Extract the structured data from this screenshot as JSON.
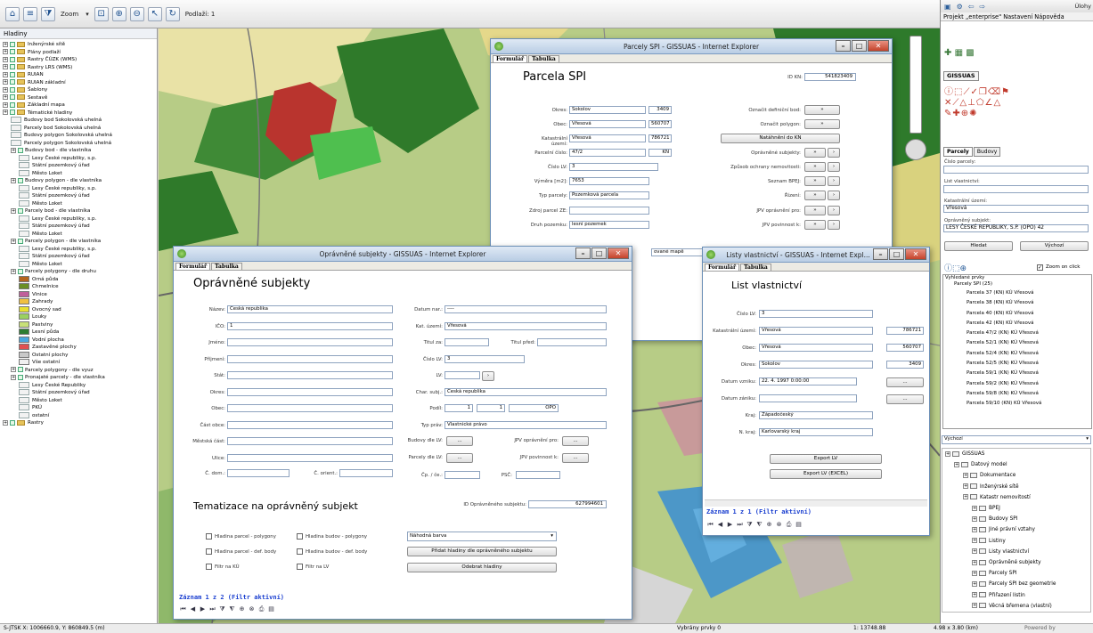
{
  "toolbar": {
    "zoom_label": "Zoom",
    "levels_label": "Podlaží: 1"
  },
  "status": {
    "coords": "S-JTSK X: 1006660.9, Y: 860849.5 (m)",
    "selected": "Vybrány prvky 0",
    "scale": "1: 13748.88",
    "size": "4.98 x 3.80 (km)",
    "powered": "Powered by"
  },
  "layers": {
    "title": "Hladiny",
    "items": [
      {
        "label": "Inženýrské sítě",
        "level": 0,
        "kind": "folder"
      },
      {
        "label": "Plány podlaží",
        "level": 0,
        "kind": "folder"
      },
      {
        "label": "Rastry ČÚZK (WMS)",
        "level": 0,
        "kind": "folder"
      },
      {
        "label": "Rastry LRS (WMS)",
        "level": 0,
        "kind": "folder"
      },
      {
        "label": "RUIAN",
        "level": 0,
        "kind": "folder"
      },
      {
        "label": "RUIAN základní",
        "level": 0,
        "kind": "folder"
      },
      {
        "label": "Šablony",
        "level": 0,
        "kind": "folder"
      },
      {
        "label": "Sestavě",
        "level": 0,
        "kind": "folder"
      },
      {
        "label": "Základní mapa",
        "level": 0,
        "kind": "folder"
      },
      {
        "label": "Tématické hladiny",
        "level": 0,
        "kind": "folder"
      },
      {
        "label": "Budovy bod Sokolovská uhelná",
        "level": 1,
        "kind": "layer"
      },
      {
        "label": "Parcely bod Sokolovská uhelná",
        "level": 1,
        "kind": "layer"
      },
      {
        "label": "Budovy polygon Sokolovská uhelná",
        "level": 1,
        "kind": "layer"
      },
      {
        "label": "Parcely polygon Sokolovská uhelná",
        "level": 1,
        "kind": "layer"
      },
      {
        "label": "Budovy bod - dle vlastníka",
        "level": 1,
        "kind": "group"
      },
      {
        "label": "Lesy České republiky, s.p.",
        "level": 2,
        "kind": "item"
      },
      {
        "label": "Státní pozemkový úřad",
        "level": 2,
        "kind": "item"
      },
      {
        "label": "Město Loket",
        "level": 2,
        "kind": "item"
      },
      {
        "label": "Budovy polygon - dle vlastníka",
        "level": 1,
        "kind": "group"
      },
      {
        "label": "Lesy České republiky, s.p.",
        "level": 2,
        "kind": "item"
      },
      {
        "label": "Státní pozemkový úřad",
        "level": 2,
        "kind": "item"
      },
      {
        "label": "Město Loket",
        "level": 2,
        "kind": "item"
      },
      {
        "label": "Parcely bod - dle vlastníka",
        "level": 1,
        "kind": "group"
      },
      {
        "label": "Lesy České republiky, s.p.",
        "level": 2,
        "kind": "item"
      },
      {
        "label": "Státní pozemkový úřad",
        "level": 2,
        "kind": "item"
      },
      {
        "label": "Město Loket",
        "level": 2,
        "kind": "item"
      },
      {
        "label": "Parcely polygon - dle vlastníka",
        "level": 1,
        "kind": "group"
      },
      {
        "label": "Lesy České republiky, s.p.",
        "level": 2,
        "kind": "item"
      },
      {
        "label": "Státní pozemkový úřad",
        "level": 2,
        "kind": "item"
      },
      {
        "label": "Město Loket",
        "level": 2,
        "kind": "item"
      },
      {
        "label": "Parcely polygony - dle druhu",
        "level": 1,
        "kind": "group"
      },
      {
        "label": "Orná půda",
        "level": 2,
        "kind": "swatch",
        "color": "#b5651d"
      },
      {
        "label": "Chmelnice",
        "level": 2,
        "kind": "swatch",
        "color": "#6b8e23"
      },
      {
        "label": "Vinice",
        "level": 2,
        "kind": "swatch",
        "color": "#c0609a"
      },
      {
        "label": "Zahrady",
        "level": 2,
        "kind": "swatch",
        "color": "#f0c040"
      },
      {
        "label": "Ovocný sad",
        "level": 2,
        "kind": "swatch",
        "color": "#e8e030"
      },
      {
        "label": "Louky",
        "level": 2,
        "kind": "swatch",
        "color": "#9ad060"
      },
      {
        "label": "Pastviny",
        "level": 2,
        "kind": "swatch",
        "color": "#c8e078"
      },
      {
        "label": "Lesní půda",
        "level": 2,
        "kind": "swatch",
        "color": "#2e7d32"
      },
      {
        "label": "Vodní plocha",
        "level": 2,
        "kind": "swatch",
        "color": "#4aa8e0"
      },
      {
        "label": "Zastavěné plochy",
        "level": 2,
        "kind": "swatch",
        "color": "#e05050"
      },
      {
        "label": "Ostatní plochy",
        "level": 2,
        "kind": "swatch",
        "color": "#c8c8c8"
      },
      {
        "label": "Vše ostatní",
        "level": 2,
        "kind": "swatch",
        "color": "#f0f0f0"
      },
      {
        "label": "Parcely polygony - dle vyuz",
        "level": 1,
        "kind": "group"
      },
      {
        "label": "Pronajaté parcely - dle vlastníka",
        "level": 1,
        "kind": "group"
      },
      {
        "label": "Lesy České Republiky",
        "level": 2,
        "kind": "item"
      },
      {
        "label": "Státní pozemkový úřad",
        "level": 2,
        "kind": "item"
      },
      {
        "label": "Město Loket",
        "level": 2,
        "kind": "item"
      },
      {
        "label": "PKÚ",
        "level": 2,
        "kind": "item"
      },
      {
        "label": "ostatní",
        "level": 2,
        "kind": "item"
      },
      {
        "label": "Rastry",
        "level": 0,
        "kind": "folder"
      }
    ]
  },
  "parcely": {
    "title": "Parcely SPI - GISSUAS - Internet Explorer",
    "tabs": [
      "Formulář",
      "Tabulka"
    ],
    "heading": "Parcela SPI",
    "id_label": "ID KN:",
    "id_value": "541823409",
    "fields": [
      {
        "label": "Okres:",
        "value": "Sokolov",
        "code": "3409"
      },
      {
        "label": "Obec:",
        "value": "Vřesová",
        "code": "560707"
      },
      {
        "label": "Katastrální území:",
        "value": "Vřesová",
        "code": "786721"
      },
      {
        "label": "Parcelní číslo:",
        "value": "47/2",
        "code": "KN"
      },
      {
        "label": "Číslo LV:",
        "value": "3",
        "code": ""
      },
      {
        "label": "Výměra [m2]:",
        "value": "7653",
        "code": ""
      },
      {
        "label": "Typ parcely:",
        "value": "Pozemková parcela",
        "code": ""
      },
      {
        "label": "Zdroj parcel ZE:",
        "value": "",
        "code": ""
      },
      {
        "label": "Druh pozemku:",
        "value": "lesní pozemek",
        "code": ""
      }
    ],
    "right_fields": [
      {
        "label": "Označit definiční bod:",
        "btn": "»"
      },
      {
        "label": "Označit polygon:",
        "btn": "»"
      },
      {
        "label": "",
        "btn": "Natáhnění do KN"
      },
      {
        "label": "Oprávněné subjekty:",
        "btn": "»"
      },
      {
        "label": "Způsob ochrany nemovitosti:",
        "btn": "»"
      },
      {
        "label": "Seznam BPEJ:",
        "btn": "»"
      },
      {
        "label": "Řízení:",
        "btn": "»"
      },
      {
        "label": "JPV oprávnění pro:",
        "btn": "»"
      },
      {
        "label": "JPV povinnost k:",
        "btn": "»"
      }
    ],
    "partial_text": "ované mapě"
  },
  "opravnene": {
    "title": "Oprávněné subjekty - GISSUAS - Internet Explorer",
    "tabs": [
      "Formulář",
      "Tabulka"
    ],
    "heading": "Oprávněné subjekty",
    "left": [
      {
        "label": "Název:",
        "value": "Česká republika"
      },
      {
        "label": "IČO:",
        "value": "1"
      },
      {
        "label": "Jméno:",
        "value": ""
      },
      {
        "label": "Příjmení:",
        "value": ""
      },
      {
        "label": "Stát:",
        "value": ""
      },
      {
        "label": "Okres:",
        "value": ""
      },
      {
        "label": "Obec:",
        "value": ""
      },
      {
        "label": "Část obce:",
        "value": ""
      },
      {
        "label": "Městská část:",
        "value": ""
      },
      {
        "label": "Ulice:",
        "value": ""
      }
    ],
    "cdom_label": "Č. dom.:",
    "corient_label": "Č. orient.:",
    "right": [
      {
        "label": "Datum nar.:",
        "value": "----"
      },
      {
        "label": "Kat. území:",
        "value": "Vřesová"
      },
      {
        "label": "Titul za:",
        "value": ""
      },
      {
        "label": "Číslo LV:",
        "value": "3"
      },
      {
        "label": "LV:",
        "value": ""
      },
      {
        "label": "Char. subj.:",
        "value": "Česká republika"
      },
      {
        "label": "Podíl:",
        "value": ""
      },
      {
        "label": "Typ práv:",
        "value": "Vlastnické právo"
      }
    ],
    "titul_pred_label": "Titul před:",
    "podil": {
      "a": "1",
      "b": "1",
      "c": "OPO"
    },
    "buttons_labels": [
      "Budovy dle LV:",
      "Parcely dle LV:",
      "JPV oprávnění pro:",
      "JPV povinnost k:"
    ],
    "cp_label": "Čp. / če.:",
    "psc_label": "PSČ:",
    "tem_heading": "Tematizace na oprávněný subjekt",
    "id_label": "ID Oprávněného subjektu:",
    "id_value": "627994601",
    "checks": [
      "Hladina parcel - polygony",
      "Hladina budov - polygony",
      "Hladina parcel - def. body",
      "Hladina budov - def. body",
      "Filtr na KÚ",
      "Filtr na LV"
    ],
    "select_value": "Náhodná barva",
    "btn_add": "Přidat hladiny dle oprávněného subjektu",
    "btn_remove": "Odebrat hladiny",
    "record": "Záznam 1 z 2 (Filtr aktivní)"
  },
  "listy": {
    "title": "Listy vlastnictví - GISSUAS - Internet Expl...",
    "tabs": [
      "Formulář",
      "Tabulka"
    ],
    "heading": "List vlastnictví",
    "fields": [
      {
        "label": "Číslo LV:",
        "value": "3",
        "code": ""
      },
      {
        "label": "Katastrální území:",
        "value": "Vřesová",
        "code": "786721"
      },
      {
        "label": "Obec:",
        "value": "Vřesová",
        "code": "560707"
      },
      {
        "label": "Okres:",
        "value": "Sokolov",
        "code": "3409"
      },
      {
        "label": "Datum vzniku:",
        "value": "22. 4. 1997 0:00:00",
        "code": ""
      },
      {
        "label": "Datum zániku:",
        "value": "",
        "code": ""
      },
      {
        "label": "Kraj:",
        "value": "Západočeský",
        "code": ""
      },
      {
        "label": "N. kraj:",
        "value": "Karlovarský kraj",
        "code": ""
      }
    ],
    "btn_export": "Export LV",
    "btn_export_excel": "Export LV (EXCEL)",
    "record": "Záznam 1 z 1 (Filtr aktivní)"
  },
  "right": {
    "project_menu": "Projekt „enterprise\"  Nastavení  Nápověda",
    "top_label": "Úlohy",
    "gissuas_tab": "GISSUAS",
    "search_tabs": [
      "Parcely",
      "Budovy"
    ],
    "search_fields": [
      {
        "label": "Číslo parcely:",
        "value": ""
      },
      {
        "label": "List vlastnictví:",
        "value": ""
      },
      {
        "label": "Katastrální území:",
        "value": "Vřesová"
      },
      {
        "label": "Oprávněný subjekt:",
        "value": "LESY ČESKÉ REPUBLIKY, S.P. (OPO) 42"
      }
    ],
    "btn_search": "Hledat",
    "btn_reset": "Výchozí",
    "zoom_on_click": "Zoom on click",
    "found_label": "Vyhledané prvky",
    "found_root": "Parcely SPI (25)",
    "found": [
      "Parcela 37 (KN) KÚ Vřesová",
      "Parcela 38 (KN) KÚ Vřesová",
      "Parcela 40 (KN) KÚ Vřesová",
      "Parcela 42 (KN) KÚ Vřesová",
      "Parcela 47/2 (KN) KÚ Vřesová",
      "Parcela 52/1 (KN) KÚ Vřesová",
      "Parcela 52/4 (KN) KÚ Vřesová",
      "Parcela 52/5 (KN) KÚ Vřesová",
      "Parcela 59/1 (KN) KÚ Vřesová",
      "Parcela 59/2 (KN) KÚ Vřesová",
      "Parcela 59/8 (KN) KÚ Vřesová",
      "Parcela 59/10 (KN) KÚ Vřesová"
    ],
    "dropdown": "Výchozí",
    "tree": [
      {
        "label": "GISSUAS",
        "level": 0
      },
      {
        "label": "Datový model",
        "level": 1
      },
      {
        "label": "Dokumentace",
        "level": 2
      },
      {
        "label": "Inženýrské sítě",
        "level": 2
      },
      {
        "label": "Katastr nemovitostí",
        "level": 2
      },
      {
        "label": "BPEJ",
        "level": 3
      },
      {
        "label": "Budovy SPI",
        "level": 3
      },
      {
        "label": "Jiné právní vztahy",
        "level": 3
      },
      {
        "label": "Listiny",
        "level": 3
      },
      {
        "label": "Listy vlastnictví",
        "level": 3
      },
      {
        "label": "Oprávněné subjekty",
        "level": 3
      },
      {
        "label": "Parcely SPI",
        "level": 3
      },
      {
        "label": "Parcely SPI bez geometrie",
        "level": 3
      },
      {
        "label": "Přiřazení listin",
        "level": 3
      },
      {
        "label": "Věcná břemena (vlastní)",
        "level": 3
      }
    ]
  }
}
